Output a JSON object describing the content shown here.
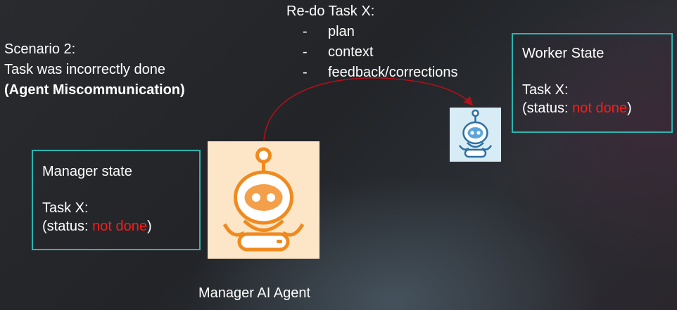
{
  "scenario": {
    "line1": "Scenario 2:",
    "line2": "Task was incorrectly done",
    "line3": "(Agent Miscommunication)"
  },
  "redo": {
    "title": "Re-do Task X:",
    "items": [
      {
        "dash": "-",
        "text": "plan"
      },
      {
        "dash": "-",
        "text": "context"
      },
      {
        "dash": "-",
        "text": "feedback/corrections"
      }
    ]
  },
  "manager_box": {
    "title": "Manager state",
    "task": "Task X:",
    "status_prefix": "(status: ",
    "status_value": "not done",
    "status_suffix": ")"
  },
  "worker_box": {
    "title": "Worker State",
    "task": "Task X:",
    "status_prefix": "(status: ",
    "status_value": "not done",
    "status_suffix": ")"
  },
  "manager_caption": "Manager AI Agent",
  "icons": {
    "manager_robot": "robot-icon",
    "worker_robot": "robot-icon",
    "arrow": "curved-arrow"
  },
  "colors": {
    "box_border": "#2bb5b1",
    "status_red": "#ff1a1a",
    "arrow": "#b0101a",
    "manager_bg": "#fde6c8",
    "manager_accent": "#f08a1e",
    "worker_bg": "#d8ecf6",
    "worker_accent": "#3a8fc8"
  }
}
